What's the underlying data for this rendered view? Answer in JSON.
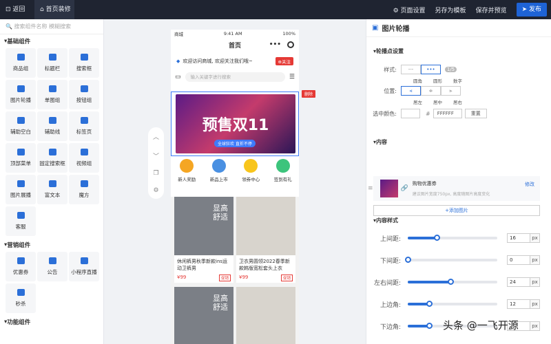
{
  "topbar": {
    "back": "返回",
    "decor_tab": "首页装修",
    "page_settings": "页面设置",
    "save_template": "另存为模板",
    "save_preview": "保存并预览",
    "publish": "发布"
  },
  "left": {
    "search_placeholder": "搜索组件名称 模糊搜索",
    "section_basic": "基础组件",
    "basic_items": [
      "商品组",
      "标题栏",
      "搜索框",
      "图片轮播",
      "单图组",
      "按钮组",
      "辅助空白",
      "辅助线",
      "标签页",
      "顶部菜单",
      "固定搜索框",
      "视频组",
      "图片展播",
      "富文本",
      "魔方",
      "客服"
    ],
    "section_marketing": "营销组件",
    "marketing_items": [
      "优惠券",
      "公告",
      "小程序直播",
      "秒杀"
    ],
    "section_function": "功能组件"
  },
  "phone": {
    "carrier": "商城",
    "time": "9:41 AM",
    "battery": "100%",
    "title": "首页",
    "follow_text": "欢迎访问商城, 欢迎关注我们哦~",
    "follow_btn": "关注",
    "search_placeholder": "输入关键字进行搜索",
    "banner_title": "预售双11",
    "banner_sub": "全球狂欢 直折不停",
    "delete_badge": "删除",
    "cats": [
      "新人奖励",
      "新品上市",
      "领券中心",
      "签到有礼"
    ],
    "products": [
      {
        "overlay": "显高\n舒适",
        "title": "休闲裤男秋季新款ins运动卫裤男",
        "price": "¥99",
        "tag": "促销"
      },
      {
        "overlay": "",
        "title": "卫衣男圆领2022春季新款韩版宽松套头上衣",
        "price": "¥99",
        "tag": "促销"
      },
      {
        "overlay": "显高\n舒适",
        "title": "",
        "price": "",
        "tag": ""
      },
      {
        "overlay": "",
        "title": "",
        "price": "",
        "tag": ""
      }
    ]
  },
  "right": {
    "title": "图片轮播",
    "section_point": "轮播点设置",
    "style_label": "样式:",
    "style_opts": [
      "圆角",
      "圆形",
      "数字"
    ],
    "pos_label": "位置:",
    "pos_opts": [
      "居左",
      "居中",
      "居右"
    ],
    "color_label": "选中颜色:",
    "hex": "FFFFFF",
    "reset": "重置",
    "section_content": "内容",
    "content_name": "购物优惠券",
    "content_edit": "修改",
    "content_hint": "建议图片宽度750px, 高度随图片高度变化",
    "add_image": "+添加图片",
    "section_style": "内容样式",
    "sliders": [
      {
        "label": "上间距:",
        "value": "16",
        "unit": "px",
        "level": 0.32
      },
      {
        "label": "下间距:",
        "value": "0",
        "unit": "px",
        "level": 0.0
      },
      {
        "label": "左右间距:",
        "value": "24",
        "unit": "px",
        "level": 0.48
      },
      {
        "label": "上边角:",
        "value": "12",
        "unit": "px",
        "level": 0.24
      },
      {
        "label": "下边角:",
        "value": "",
        "unit": "px",
        "level": 0.24
      }
    ]
  },
  "watermark": "头条 @一飞开源",
  "colors": {
    "accent": "#2b6fd8",
    "danger": "#e53935",
    "topbar": "#1f2431"
  }
}
